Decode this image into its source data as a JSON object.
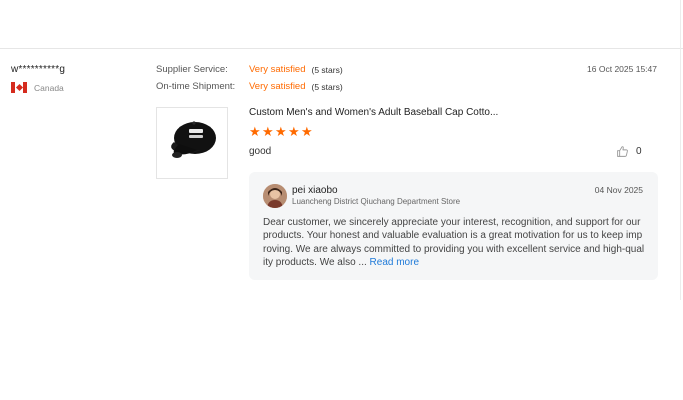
{
  "reviewer": {
    "name": "w**********g",
    "country": "Canada",
    "flag_icon": "canada-flag-icon"
  },
  "ratings": [
    {
      "label": "Supplier Service:",
      "value": "Very satisfied",
      "stars_text": "(5 stars)"
    },
    {
      "label": "On-time Shipment:",
      "value": "Very satisfied",
      "stars_text": "(5 stars)"
    }
  ],
  "review": {
    "date": "16 Oct 2025 15:47",
    "product_title": "Custom Men's and Women's Adult Baseball Cap Cotto...",
    "product_image_icon": "baseball-cap-image",
    "star_count": 5,
    "text": "good",
    "like_count": "0"
  },
  "reply": {
    "name": "pei xiaobo",
    "store": "Luancheng District Qiuchang Department Store",
    "date": "04 Nov 2025",
    "body": "Dear customer, we sincerely appreciate your interest, recognition, and support for our products. Your honest and valuable evaluation is a great motivation for us to keep imp roving. We are always committed to providing you with excellent service and high-qual ity products. We also ... ",
    "read_more": "Read more"
  },
  "colors": {
    "accent": "#ff6a00",
    "link": "#1f7ad8",
    "reply_bg": "#f5f6f7"
  }
}
